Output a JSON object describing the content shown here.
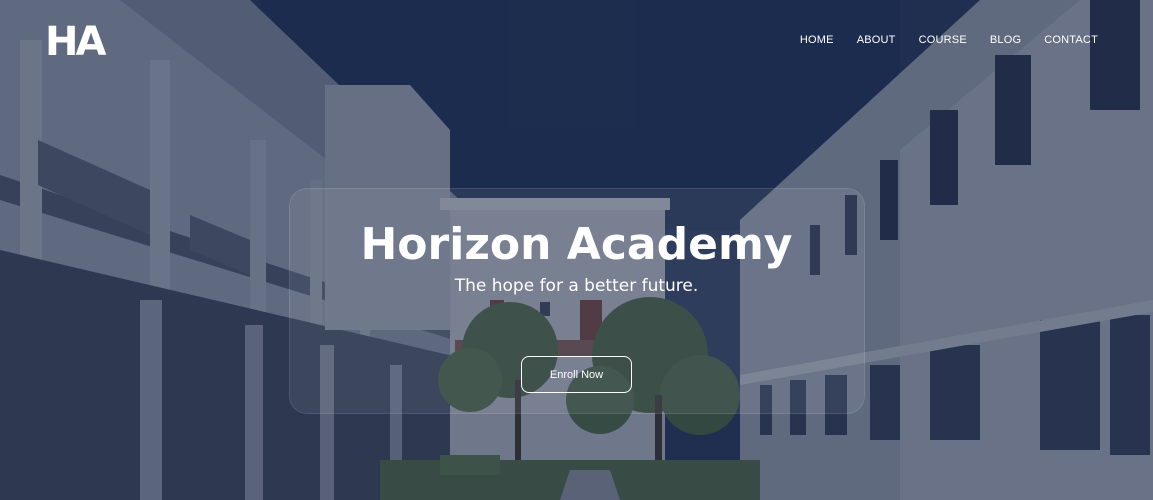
{
  "brand": {
    "logo_text": "HA"
  },
  "nav": {
    "items": [
      {
        "label": "HOME"
      },
      {
        "label": "ABOUT"
      },
      {
        "label": "COURSE"
      },
      {
        "label": "BLOG"
      },
      {
        "label": "CONTACT"
      }
    ]
  },
  "hero": {
    "title": "Horizon Academy",
    "subtitle": "The hope for a better future.",
    "cta_label": "Enroll Now",
    "background_description_icon": "campus-courtyard-photo"
  },
  "colors": {
    "overlay": "#182442",
    "sky": "#1f3153",
    "text": "#ffffff"
  }
}
